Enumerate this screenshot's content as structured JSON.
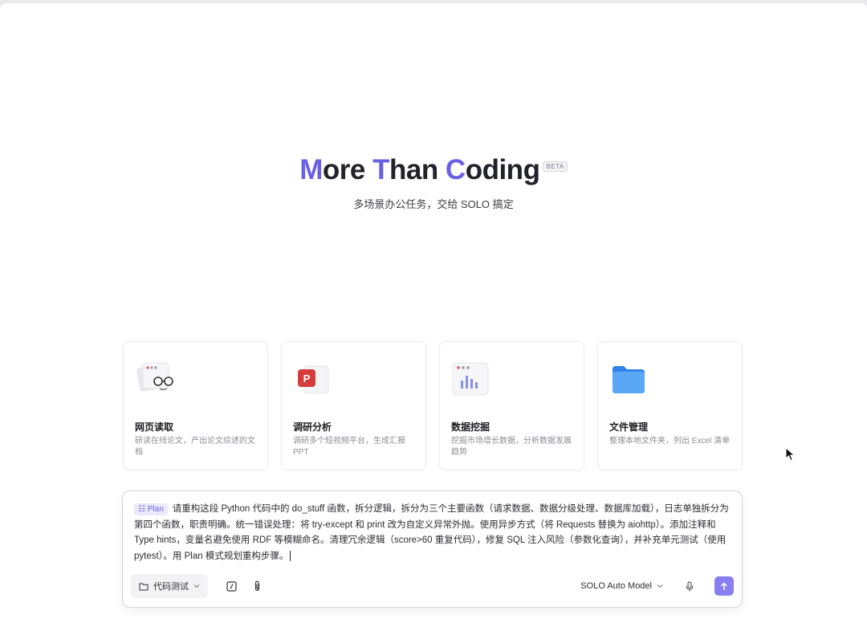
{
  "hero": {
    "title_parts": [
      {
        "accent": "M",
        "rest": "ore "
      },
      {
        "accent": "T",
        "rest": "han "
      },
      {
        "accent": "C",
        "rest": "oding"
      }
    ],
    "badge": "BETA",
    "subtitle": "多场景办公任务，交给 SOLO 搞定"
  },
  "cards": [
    {
      "title": "网页读取",
      "desc": "研读在线论文，产出论文综述的文档",
      "icon": "glasses-document-icon"
    },
    {
      "title": "调研分析",
      "desc": "调研多个短视频平台，生成汇报PPT",
      "icon": "ppt-icon"
    },
    {
      "title": "数据挖掘",
      "desc": "挖掘市场增长数据，分析数据发展趋势",
      "icon": "bar-chart-icon"
    },
    {
      "title": "文件管理",
      "desc": "整理本地文件夹，列出 Excel 清单",
      "icon": "folder-icon"
    }
  ],
  "composer": {
    "mode_chip": "Plan",
    "prompt": "请重构这段 Python 代码中的 do_stuff 函数，拆分逻辑，拆分为三个主要函数（请求数据、数据分级处理、数据库加载），日志单独拆分为第四个函数，职责明确。统一错误处理：将 try-except 和 print 改为自定义异常外抛。使用异步方式（将 Requests 替换为 aiohttp）。添加注释和 Type hints，变量名避免使用 RDF 等模糊命名。清理冗余逻辑（score>60 重复代码），修复 SQL 注入风险（参数化查询），并补充单元测试（使用 pytest）。用 Plan 模式规划重构步骤。",
    "folder_label": "代码测试",
    "model_label": "SOLO Auto Model"
  },
  "colors": {
    "accent": "#6a60e6",
    "send": "#8a7ff0"
  }
}
